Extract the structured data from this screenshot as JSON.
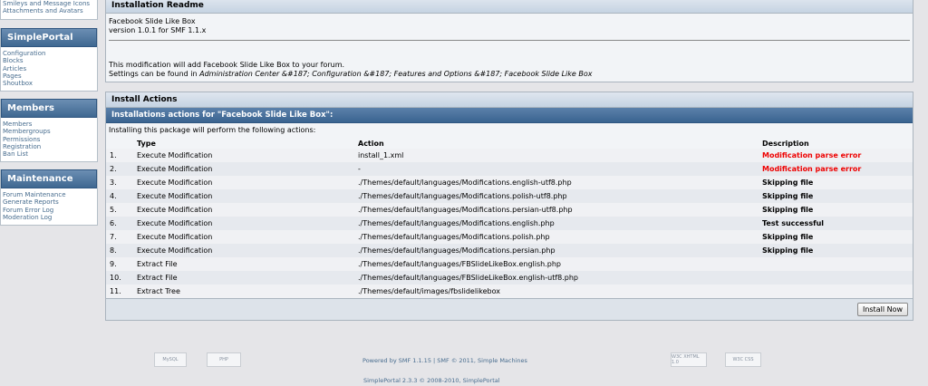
{
  "sidebar": {
    "top_links": [
      "Smileys and Message Icons",
      "Attachments and Avatars"
    ],
    "sections": [
      {
        "title": "SimplePortal",
        "links": [
          "Configuration",
          "Blocks",
          "Articles",
          "Pages",
          "Shoutbox"
        ]
      },
      {
        "title": "Members",
        "links": [
          "Members",
          "Membergroups",
          "Permissions",
          "Registration",
          "Ban List"
        ]
      },
      {
        "title": "Maintenance",
        "links": [
          "Forum Maintenance",
          "Generate Reports",
          "Forum Error Log",
          "Moderation Log"
        ]
      }
    ]
  },
  "readme": {
    "title": "Installation Readme",
    "name_line": "Facebook Slide Like Box",
    "version_line": "version 1.0.1 for SMF 1.1.x",
    "description": "This modification will add Facebook Slide Like Box to your forum.",
    "settings_prefix": "Settings can be found in ",
    "settings_path": "Administration Center &#187; Configuration &#187; Features and Options &#187; Facebook Slide Like Box"
  },
  "install": {
    "title": "Install Actions",
    "category": "Installations actions for \"Facebook Slide Like Box\":",
    "intro": "Installing this package will perform the following actions:",
    "columns": {
      "type": "Type",
      "action": "Action",
      "description": "Description"
    },
    "rows": [
      {
        "num": "1.",
        "type": "Execute Modification",
        "action": "install_1.xml",
        "desc": "Modification parse error",
        "desc_style": "error"
      },
      {
        "num": "2.",
        "type": "Execute Modification",
        "action": "-",
        "desc": "Modification parse error",
        "desc_style": "error"
      },
      {
        "num": "3.",
        "type": "Execute Modification",
        "action": "./Themes/default/languages/Modifications.english-utf8.php",
        "desc": "Skipping file",
        "desc_style": "bold"
      },
      {
        "num": "4.",
        "type": "Execute Modification",
        "action": "./Themes/default/languages/Modifications.polish-utf8.php",
        "desc": "Skipping file",
        "desc_style": "bold"
      },
      {
        "num": "5.",
        "type": "Execute Modification",
        "action": "./Themes/default/languages/Modifications.persian-utf8.php",
        "desc": "Skipping file",
        "desc_style": "bold"
      },
      {
        "num": "6.",
        "type": "Execute Modification",
        "action": "./Themes/default/languages/Modifications.english.php",
        "desc": "Test successful",
        "desc_style": "bold"
      },
      {
        "num": "7.",
        "type": "Execute Modification",
        "action": "./Themes/default/languages/Modifications.polish.php",
        "desc": "Skipping file",
        "desc_style": "bold"
      },
      {
        "num": "8.",
        "type": "Execute Modification",
        "action": "./Themes/default/languages/Modifications.persian.php",
        "desc": "Skipping file",
        "desc_style": "bold"
      },
      {
        "num": "9.",
        "type": "Extract File",
        "action": "./Themes/default/languages/FBSlideLikeBox.english.php",
        "desc": "",
        "desc_style": "none"
      },
      {
        "num": "10.",
        "type": "Extract File",
        "action": "./Themes/default/languages/FBSlideLikeBox.english-utf8.php",
        "desc": "",
        "desc_style": "none"
      },
      {
        "num": "11.",
        "type": "Extract Tree",
        "action": "./Themes/default/images/fbslidelikebox",
        "desc": "",
        "desc_style": "none"
      }
    ],
    "button_label": "Install Now"
  },
  "footer": {
    "powered": "Powered by SMF 1.1.15 | SMF © 2011, Simple Machines",
    "portal": "SimplePortal 2.3.3 © 2008-2010, SimplePortal",
    "badges": [
      "MySQL",
      "PHP",
      "W3C XHTML 1.0",
      "W3C CSS"
    ]
  },
  "colors": {
    "error": "#ee0000",
    "header_blue": "#3f6891",
    "link": "#476c8e"
  }
}
